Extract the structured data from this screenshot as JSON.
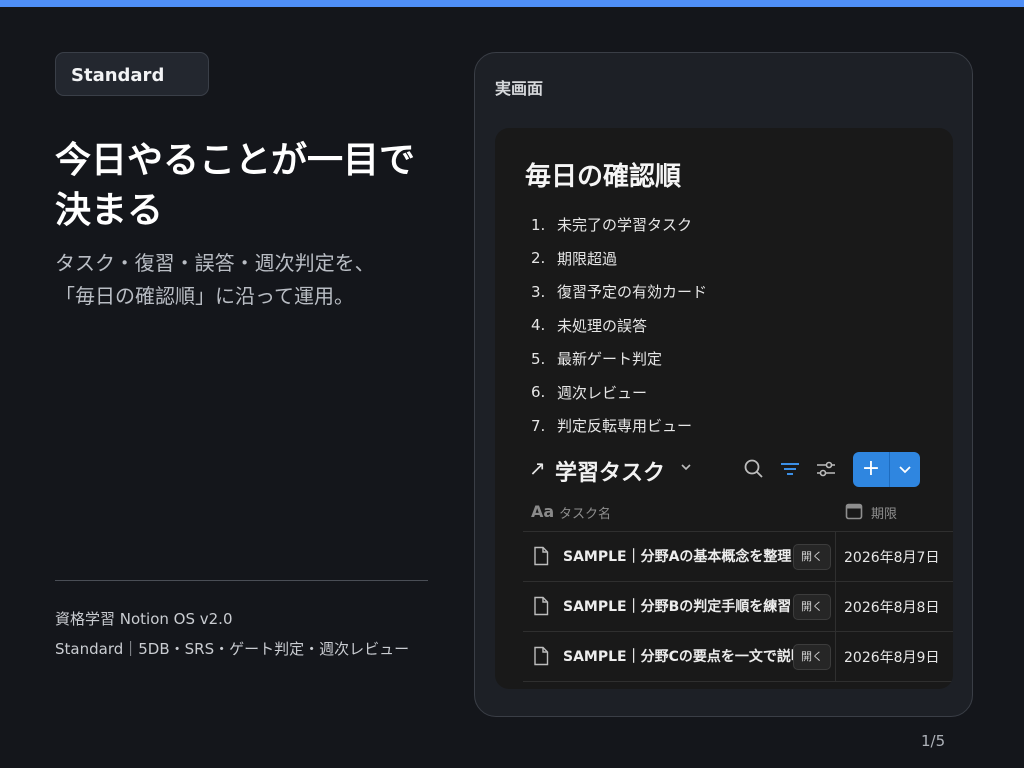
{
  "badge": "Standard",
  "hero": {
    "title_line1": "今日やることが一目で",
    "title_line2": "決まる",
    "sub_line1": "タスク・復習・誤答・週次判定を、",
    "sub_line2": "「毎日の確認順」に沿って運用。"
  },
  "footer": {
    "line1": "資格学習 Notion OS v2.0",
    "line2": "Standard｜5DB・SRS・ゲート判定・週次レビュー"
  },
  "page_number": "1/5",
  "panel": {
    "label": "実画面",
    "screen_title": "毎日の確認順",
    "order": [
      {
        "num": "1.",
        "text": "未完了の学習タスク"
      },
      {
        "num": "2.",
        "text": "期限超過"
      },
      {
        "num": "3.",
        "text": "復習予定の有効カード"
      },
      {
        "num": "4.",
        "text": "未処理の誤答"
      },
      {
        "num": "5.",
        "text": "最新ゲート判定"
      },
      {
        "num": "6.",
        "text": "週次レビュー"
      },
      {
        "num": "7.",
        "text": "判定反転専用ビュー"
      }
    ],
    "database": {
      "arrow": "↗",
      "title": "学習タスク",
      "new_label": "+",
      "columns": {
        "aa": "Aa",
        "name": "タスク名",
        "date": "期限"
      },
      "open_label": "開く",
      "rows": [
        {
          "name": "SAMPLE｜分野Aの基本概念を整理",
          "date": "2026年8月7日"
        },
        {
          "name": "SAMPLE｜分野Bの判定手順を練習",
          "date": "2026年8月8日"
        },
        {
          "name": "SAMPLE｜分野Cの要点を一文で説明",
          "date": "2026年8月9日"
        }
      ]
    }
  },
  "colors": {
    "accent": "#4f8ff7",
    "button": "#2f86e0",
    "background": "#14161b"
  }
}
